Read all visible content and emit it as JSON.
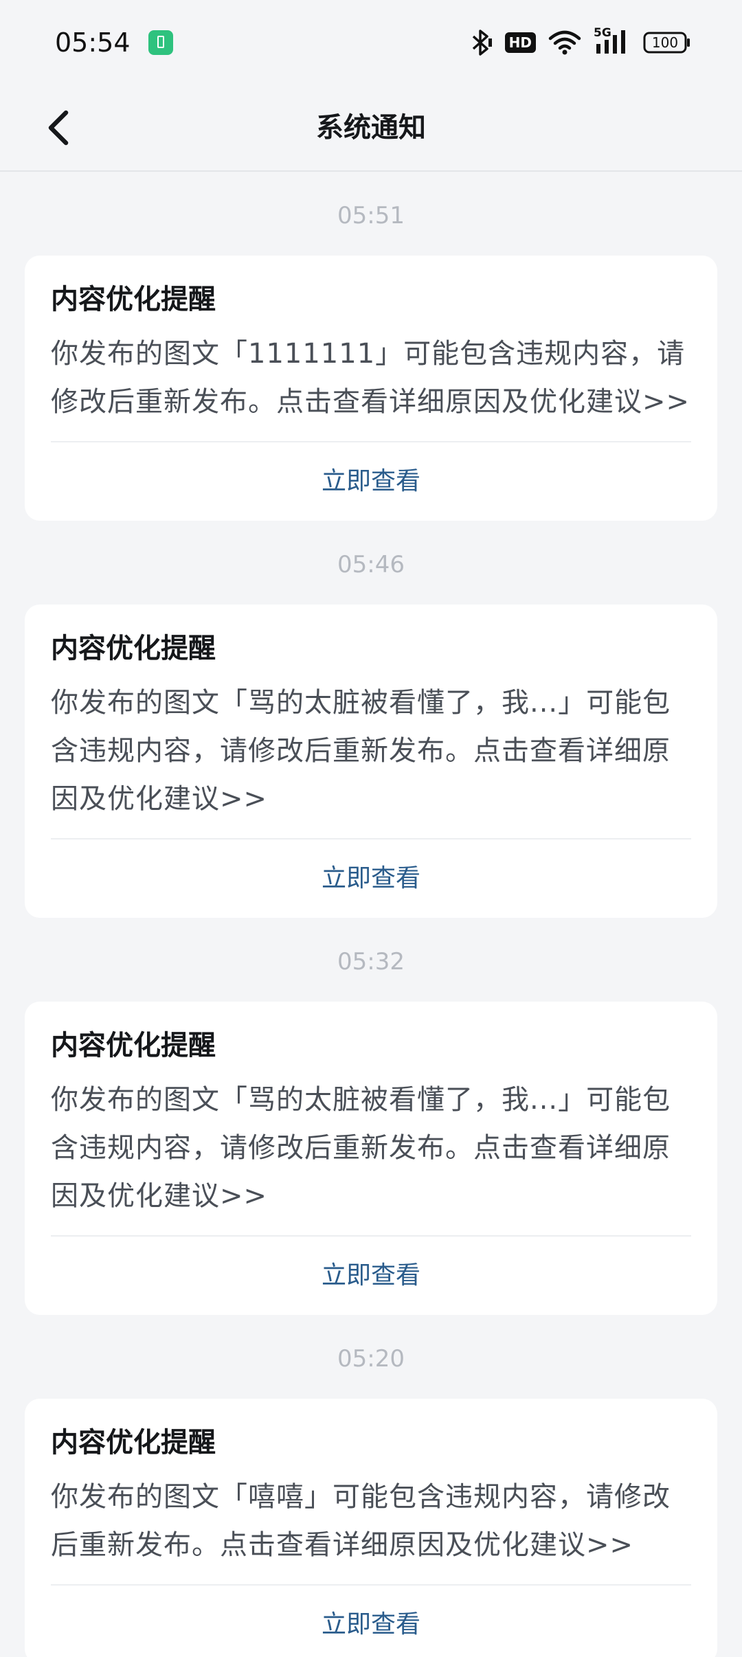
{
  "status_bar": {
    "time": "05:54",
    "battery_level": "100",
    "network": "5G",
    "hd_label": "HD"
  },
  "header": {
    "title": "系统通知"
  },
  "notifications": [
    {
      "time": "05:51",
      "title": "内容优化提醒",
      "body": "你发布的图文「1111111」可能包含违规内容，请修改后重新发布。点击查看详细原因及优化建议>>",
      "action": "立即查看"
    },
    {
      "time": "05:46",
      "title": "内容优化提醒",
      "body": "你发布的图文「骂的太脏被看懂了，我...」可能包含违规内容，请修改后重新发布。点击查看详细原因及优化建议>>",
      "action": "立即查看"
    },
    {
      "time": "05:32",
      "title": "内容优化提醒",
      "body": "你发布的图文「骂的太脏被看懂了，我...」可能包含违规内容，请修改后重新发布。点击查看详细原因及优化建议>>",
      "action": "立即查看"
    },
    {
      "time": "05:20",
      "title": "内容优化提醒",
      "body": "你发布的图文「嘻嘻」可能包含违规内容，请修改后重新发布。点击查看详细原因及优化建议>>",
      "action": "立即查看"
    }
  ],
  "icons": {
    "back": "chevron-left-icon",
    "bluetooth": "bluetooth-icon",
    "hd": "hd-icon",
    "wifi": "wifi-icon",
    "signal": "signal-icon",
    "battery": "battery-icon",
    "battery_saver": "battery-saver-icon"
  },
  "colors": {
    "background": "#f4f5f7",
    "card": "#ffffff",
    "action_link": "#2a5c8c",
    "timestamp": "#b5b9c0",
    "battery_saver": "#2ec27e"
  }
}
